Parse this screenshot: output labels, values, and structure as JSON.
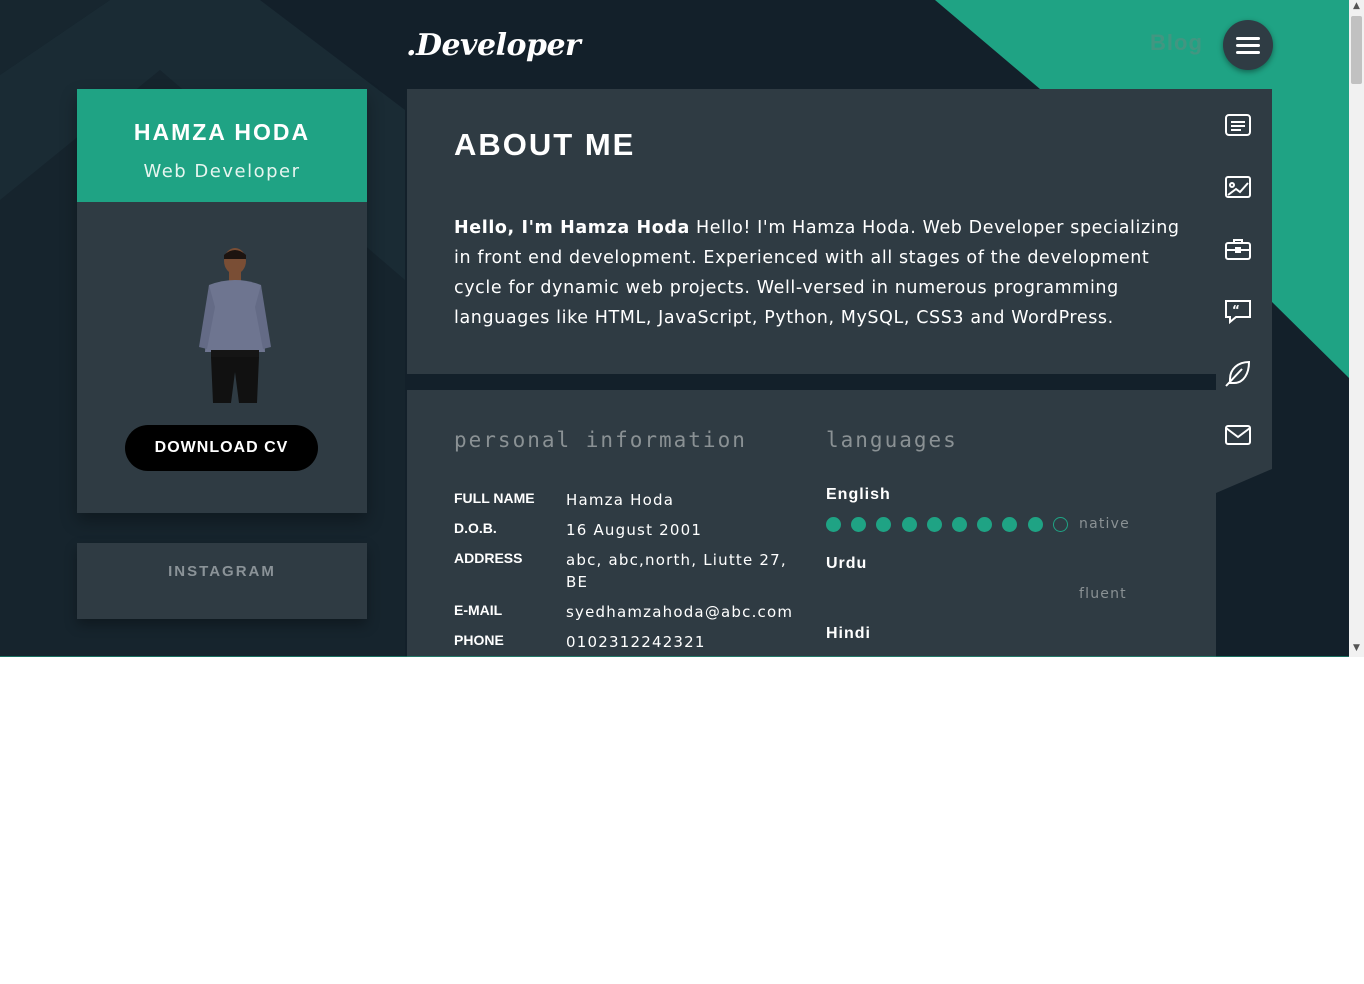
{
  "header": {
    "logo": ".Developer",
    "blog_label": "Blog",
    "menu_icon": "hamburger-icon"
  },
  "profile": {
    "name": "HAMZA HODA",
    "title": "Web Developer",
    "download_label": "DOWNLOAD CV"
  },
  "instagram": {
    "label": "INSTAGRAM"
  },
  "about": {
    "heading": "ABOUT ME",
    "intro_bold": "Hello, I'm Hamza Hoda",
    "text": " Hello! I'm Hamza Hoda. Web Developer specializing in front end development. Experienced with all stages of the development cycle for dynamic web projects. Well-versed in numerous programming languages like HTML, JavaScript, Python, MySQL, CSS3 and WordPress."
  },
  "side_nav": [
    {
      "icon": "resume-card-icon"
    },
    {
      "icon": "portfolio-image-icon"
    },
    {
      "icon": "briefcase-icon"
    },
    {
      "icon": "quote-bubble-icon"
    },
    {
      "icon": "feather-icon"
    },
    {
      "icon": "envelope-icon"
    }
  ],
  "personal_info": {
    "title": "personal information",
    "rows": [
      {
        "key": "FULL NAME",
        "value": "Hamza Hoda"
      },
      {
        "key": "D.O.B.",
        "value": "16 August 2001"
      },
      {
        "key": "ADDRESS",
        "value": "abc, abc,north, Liutte 27, BE"
      },
      {
        "key": "E-MAIL",
        "value": "syedhamzahoda@abc.com"
      },
      {
        "key": "PHONE",
        "value": "0102312242321"
      }
    ]
  },
  "languages": {
    "title": "languages",
    "items": [
      {
        "name": "English",
        "level": "native",
        "rating": 9,
        "max": 10
      },
      {
        "name": "Urdu",
        "level": "fluent"
      },
      {
        "name": "Hindi",
        "level": ""
      }
    ]
  },
  "colors": {
    "accent": "#1fa384",
    "background": "#13202a",
    "card": "#2f3b43"
  }
}
